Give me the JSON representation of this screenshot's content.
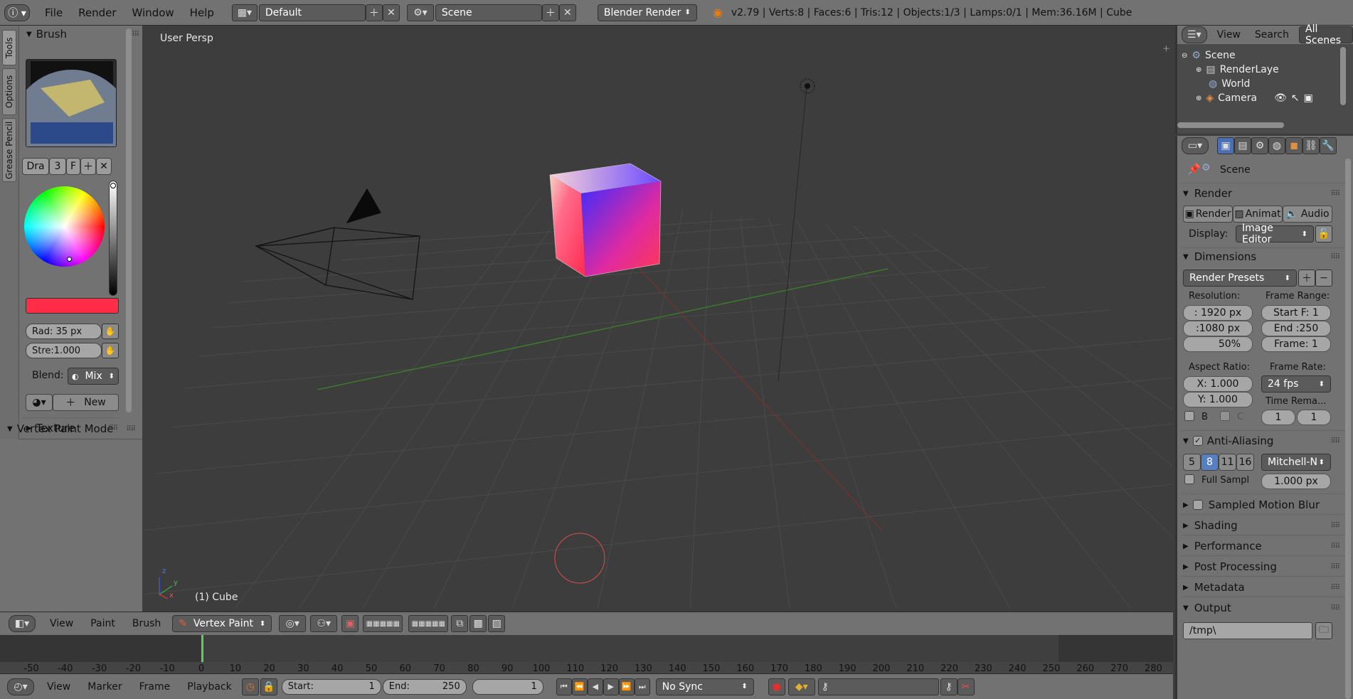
{
  "topbar": {
    "menus": [
      "File",
      "Render",
      "Window",
      "Help"
    ],
    "layout": "Default",
    "scene": "Scene",
    "engine": "Blender Render",
    "status": "v2.79 | Verts:8 | Faces:6 | Tris:12 | Objects:1/3 | Lamps:0/1 | Mem:36.16M | Cube"
  },
  "lefttabs": [
    "Tools",
    "Options",
    "Grease Pencil"
  ],
  "toolpanel": {
    "brush_header": "Brush",
    "brush_name": "Dra",
    "brush_users": "3",
    "brush_fake": "F",
    "radius": "Rad: 35 px",
    "strength": "Stre:1.000",
    "blend_label": "Blend:",
    "blend_value": "Mix",
    "new_label": "New",
    "texture_header": "Texture",
    "mode_header": "Vertex Paint Mode",
    "color": "#ff2d45"
  },
  "viewport": {
    "label": "User Persp",
    "object_label": "(1) Cube",
    "axis_x": "y",
    "axis_z": "z",
    "axis_y": "x"
  },
  "viewbar": {
    "menus": [
      "View",
      "Paint",
      "Brush"
    ],
    "mode": "Vertex Paint"
  },
  "timeline": {
    "ticks": [
      "-50",
      "-40",
      "-30",
      "-20",
      "-10",
      "0",
      "10",
      "20",
      "30",
      "40",
      "50",
      "60",
      "70",
      "80",
      "90",
      "100",
      "110",
      "120",
      "130",
      "140",
      "150",
      "160",
      "170",
      "180",
      "190",
      "200",
      "210",
      "220",
      "230",
      "240",
      "250",
      "260",
      "270",
      "280"
    ],
    "current_frame_tick": "0"
  },
  "tlbar": {
    "menus": [
      "View",
      "Marker",
      "Frame",
      "Playback"
    ],
    "start_label": "Start:",
    "start_value": "1",
    "end_label": "End:",
    "end_value": "250",
    "current": "1",
    "sync": "No Sync"
  },
  "outliner": {
    "menus": [
      "View",
      "Search"
    ],
    "filter": "All Scenes",
    "items": [
      "Scene",
      "RenderLaye",
      "World",
      "Camera"
    ]
  },
  "props": {
    "scene_label": "Scene",
    "render_header": "Render",
    "render_btn": "Render",
    "anim_btn": "Animat",
    "audio_btn": "Audio",
    "display_label": "Display:",
    "display_value": "Image Editor",
    "dimensions_header": "Dimensions",
    "presets": "Render Presets",
    "resolution_label": "Resolution:",
    "frame_range_label": "Frame Range:",
    "res_x": ": 1920 px",
    "res_y": ":1080 px",
    "res_pct": "50%",
    "start_f": "Start F: 1",
    "end_f": "End :250",
    "frame": "Frame: 1",
    "aspect_label": "Aspect Ratio:",
    "frame_rate_label": "Frame Rate:",
    "asp_x": "X:  1.000",
    "asp_y": "Y:  1.000",
    "fps": "24 fps",
    "time_remap": "Time Rema...",
    "b_label": "B",
    "c_label": "C",
    "remap_a": "1",
    "remap_b": "1",
    "aa_header": "Anti-Aliasing",
    "aa_samples": [
      "5",
      "8",
      "11",
      "16"
    ],
    "aa_filter": "Mitchell-N",
    "full_sample": "Full Sampl",
    "aa_size": "1.000 px",
    "collapsed": [
      "Sampled Motion Blur",
      "Shading",
      "Performance",
      "Post Processing",
      "Metadata"
    ],
    "output_header": "Output",
    "output_path": "/tmp\\"
  }
}
